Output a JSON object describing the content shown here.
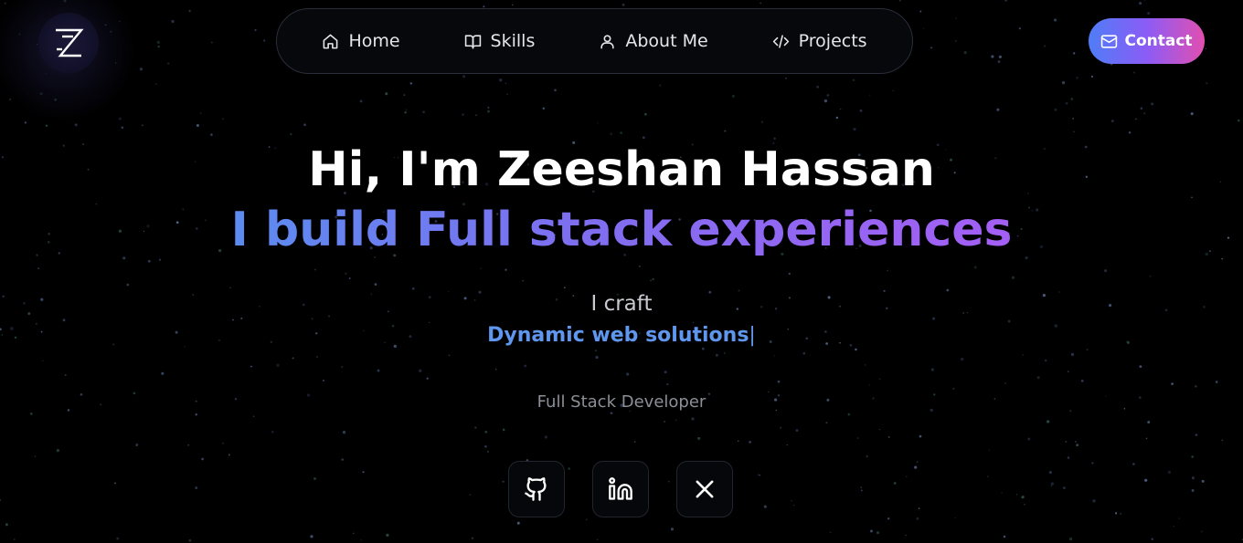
{
  "logo": {
    "icon": "z-logo-icon"
  },
  "nav": {
    "items": [
      {
        "label": "Home",
        "icon": "home-icon"
      },
      {
        "label": "Skills",
        "icon": "book-icon"
      },
      {
        "label": "About Me",
        "icon": "user-icon"
      },
      {
        "label": "Projects",
        "icon": "code-icon"
      }
    ]
  },
  "contact": {
    "label": "Contact",
    "icon": "mail-icon"
  },
  "hero": {
    "title": "Hi, I'm Zeeshan Hassan",
    "subtitle": "I build Full stack experiences",
    "craft_label": "I craft",
    "typing_text": "Dynamic web solutions",
    "cursor": "|",
    "role": "Full Stack Developer"
  },
  "socials": [
    {
      "icon": "github-icon"
    },
    {
      "icon": "linkedin-icon"
    },
    {
      "icon": "x-icon"
    }
  ],
  "colors": {
    "background": "#000000",
    "accent_blue": "#5f97ee",
    "accent_purple": "#a45ff5",
    "accent_pink": "#e14fb0"
  }
}
